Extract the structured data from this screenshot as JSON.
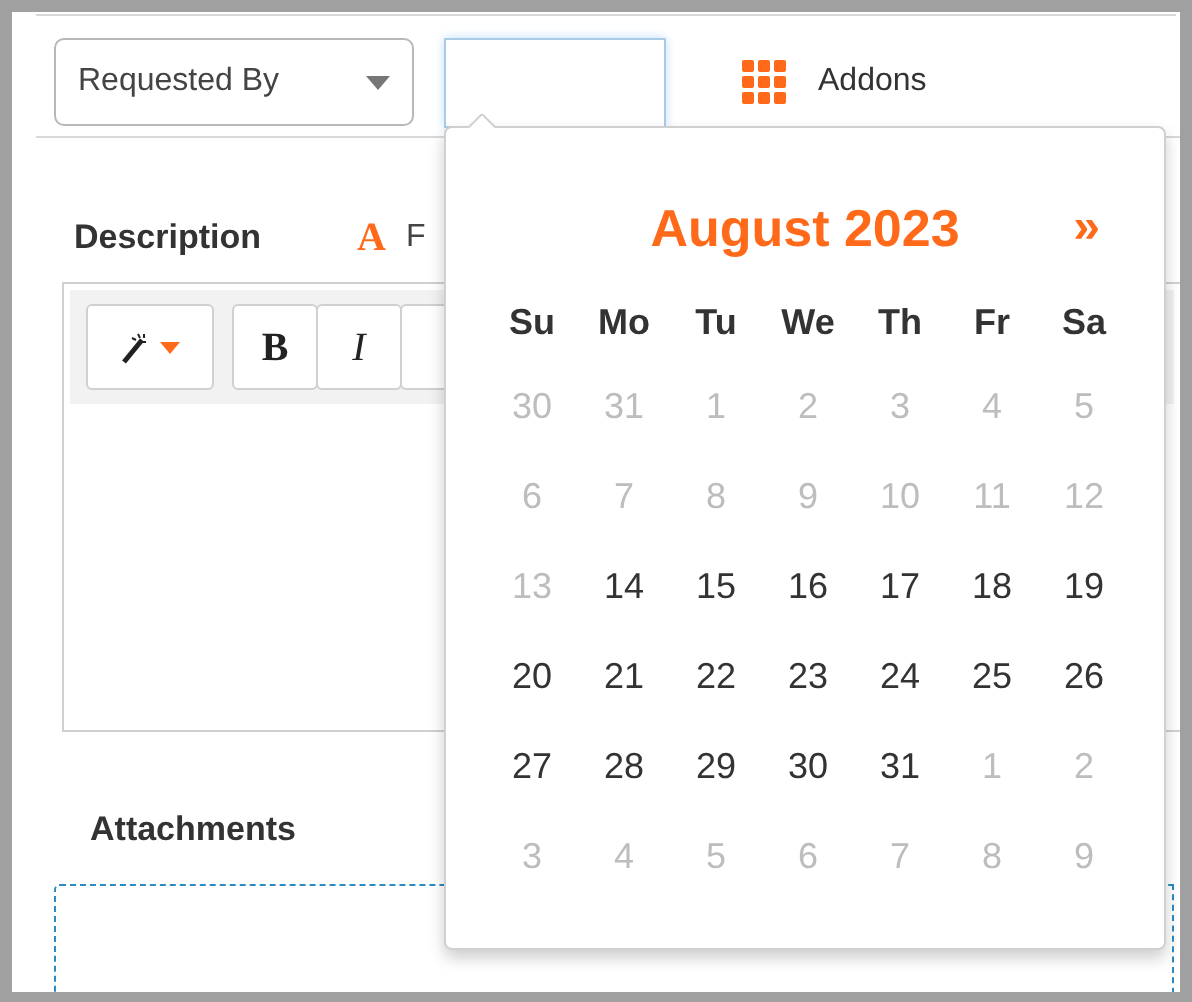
{
  "filters": {
    "requested_by": {
      "value": "Requested By"
    },
    "date_field": {
      "focused": true
    },
    "addons": {
      "label": "Addons"
    }
  },
  "description": {
    "label": "Description",
    "font_icon": "A",
    "font_label": "F",
    "toolbar": [
      {
        "kind": "magic"
      },
      {
        "kind": "letter",
        "label": "B"
      },
      {
        "kind": "letter",
        "label": "I"
      },
      {
        "kind": "covered"
      }
    ]
  },
  "attachments": {
    "label": "Attachments"
  },
  "calendar": {
    "title": "August 2023",
    "next": "»",
    "weekdays": [
      "Su",
      "Mo",
      "Tu",
      "We",
      "Th",
      "Fr",
      "Sa"
    ],
    "weeks": [
      [
        {
          "day": "30",
          "muted": true
        },
        {
          "day": "31",
          "muted": true
        },
        {
          "day": "1",
          "muted": true
        },
        {
          "day": "2",
          "muted": true
        },
        {
          "day": "3",
          "muted": true
        },
        {
          "day": "4",
          "muted": true
        },
        {
          "day": "5",
          "muted": true
        }
      ],
      [
        {
          "day": "6",
          "muted": true
        },
        {
          "day": "7",
          "muted": true
        },
        {
          "day": "8",
          "muted": true
        },
        {
          "day": "9",
          "muted": true
        },
        {
          "day": "10",
          "muted": true
        },
        {
          "day": "11",
          "muted": true
        },
        {
          "day": "12",
          "muted": true
        }
      ],
      [
        {
          "day": "13",
          "muted": true
        },
        {
          "day": "14",
          "muted": false
        },
        {
          "day": "15",
          "muted": false
        },
        {
          "day": "16",
          "muted": false
        },
        {
          "day": "17",
          "muted": false
        },
        {
          "day": "18",
          "muted": false
        },
        {
          "day": "19",
          "muted": false
        }
      ],
      [
        {
          "day": "20",
          "muted": false
        },
        {
          "day": "21",
          "muted": false
        },
        {
          "day": "22",
          "muted": false
        },
        {
          "day": "23",
          "muted": false
        },
        {
          "day": "24",
          "muted": false
        },
        {
          "day": "25",
          "muted": false
        },
        {
          "day": "26",
          "muted": false
        }
      ],
      [
        {
          "day": "27",
          "muted": false
        },
        {
          "day": "28",
          "muted": false
        },
        {
          "day": "29",
          "muted": false
        },
        {
          "day": "30",
          "muted": false
        },
        {
          "day": "31",
          "muted": false
        },
        {
          "day": "1",
          "muted": true
        },
        {
          "day": "2",
          "muted": true
        }
      ],
      [
        {
          "day": "3",
          "muted": true
        },
        {
          "day": "4",
          "muted": true
        },
        {
          "day": "5",
          "muted": true
        },
        {
          "day": "6",
          "muted": true
        },
        {
          "day": "7",
          "muted": true
        },
        {
          "day": "8",
          "muted": true
        },
        {
          "day": "9",
          "muted": true
        }
      ]
    ]
  }
}
